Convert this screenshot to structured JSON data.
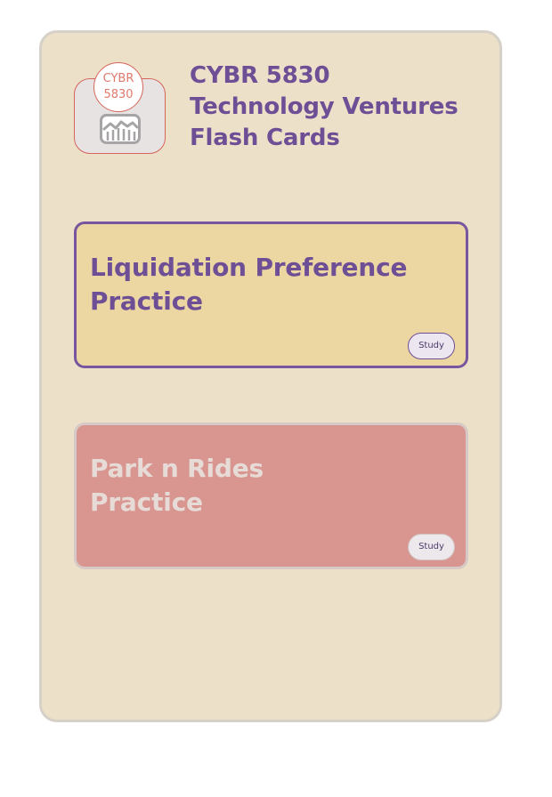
{
  "app": {
    "logo_text": [
      "CYBR",
      "5830"
    ],
    "title_lines": [
      "CYBR 5830",
      "Technology Ventures",
      "Flash Cards"
    ]
  },
  "decks": [
    {
      "title_lines": [
        "Liquidation Preference",
        "Practice"
      ],
      "study_label": "Study",
      "state": "selected"
    },
    {
      "title_lines": [
        "Park n Rides",
        "Practice"
      ],
      "study_label": "Study",
      "state": "muted"
    }
  ],
  "colors": {
    "panel_bg": "#ece1c8",
    "accent_purple": "#6e4f96",
    "deck_selected_bg": "#ecd7a3",
    "deck_muted_bg": "#d99690",
    "logo_accent": "#d6655a"
  },
  "icons": {
    "logo_icon": "chart-icon"
  }
}
